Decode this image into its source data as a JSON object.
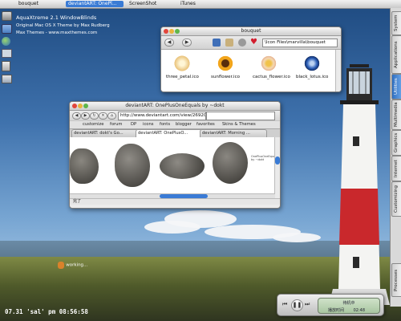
{
  "taskbar": {
    "items": [
      "bouquet",
      "deviantART: OnePl...",
      "ScreenShot",
      "iTunes"
    ]
  },
  "desktop_info": {
    "line1": "AquaXtreme 2.1 WindowBlinds",
    "line2": "Original Mac OS X Theme by Max Rudberg",
    "line3": "Max Themes - www.maxthemes.com"
  },
  "drawer": {
    "tabs": [
      "System",
      "Applications",
      "Utilities",
      "Multimedia",
      "Graphics",
      "Internet",
      "Customizing",
      "Processes"
    ],
    "selected": "Utilities"
  },
  "bouquet_window": {
    "title": "bouquet",
    "path": "\\Icon Files\\marvilla\\bouquet",
    "icons": [
      {
        "label": "three_petal.ico",
        "color": "#e9c27a"
      },
      {
        "label": "sunflower.ico",
        "color": "#f2a51b"
      },
      {
        "label": "cactus_flower.ico",
        "color": "#f4d8b4"
      },
      {
        "label": "black_lotus.ico",
        "color": "#2c5fb8"
      }
    ]
  },
  "browser_window": {
    "title": "deviantART: OnePlusOneEquals by ~dokt",
    "url": "http://www.deviantart.com/view/26920",
    "bookmarks": [
      "customize",
      "forum",
      "DP",
      "icons",
      "fonts",
      "blogger",
      "favorites",
      "Skins & Themes"
    ],
    "tabs": [
      "deviantART: dokt's Go...",
      "deviantART: OnePlusO...",
      "deviantART: Morning ..."
    ],
    "side_caption": "OnePlusOneEquals by ~dokt",
    "status": "完了"
  },
  "desktop": {
    "working_label": "working...",
    "clock_text": "07.31 'sal' pm 08:56:58"
  },
  "player": {
    "line1": "待机中",
    "line2_left": "播放时间",
    "line2_right": "02:48"
  },
  "colors": {
    "accent": "#3a7bd5",
    "close": "#e2463c",
    "minimize": "#e9b43b",
    "zoom": "#5fb64a"
  }
}
